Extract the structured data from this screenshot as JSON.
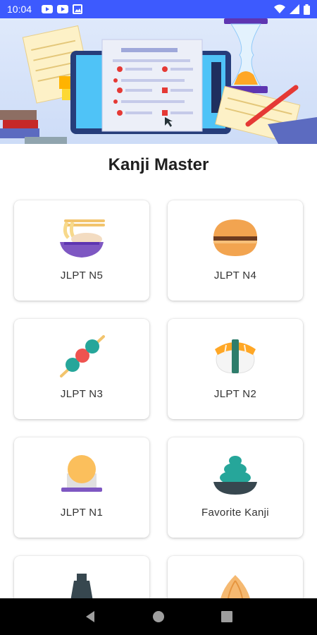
{
  "status_bar": {
    "time": "10:04",
    "notification_icons": [
      "youtube-icon",
      "youtube-icon",
      "image-icon"
    ],
    "system_icons": [
      "wifi-icon",
      "signal-icon",
      "battery-icon"
    ]
  },
  "app": {
    "title": "Kanji Master"
  },
  "cards": [
    {
      "label": "JLPT N5",
      "icon": "ramen-icon"
    },
    {
      "label": "JLPT N4",
      "icon": "dorayaki-icon"
    },
    {
      "label": "JLPT N3",
      "icon": "dango-icon"
    },
    {
      "label": "JLPT N2",
      "icon": "sushi-icon"
    },
    {
      "label": "JLPT N1",
      "icon": "onigiri-icon"
    },
    {
      "label": "Favorite Kanji",
      "icon": "wasabi-icon"
    },
    {
      "label": "",
      "icon": "sake-bottle-icon"
    },
    {
      "label": "",
      "icon": "onion-icon"
    }
  ],
  "nav_bar": {
    "buttons": [
      "back-icon",
      "home-icon",
      "recents-icon"
    ]
  },
  "colors": {
    "status_bar": "#3d5afe",
    "nav_bar": "#000000",
    "accent_purple": "#7e57c2"
  }
}
